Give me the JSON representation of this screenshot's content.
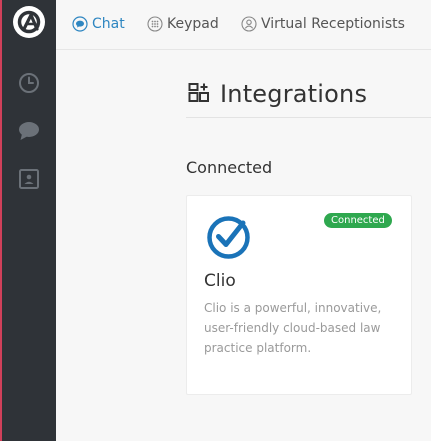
{
  "topbar": {
    "tabs": [
      {
        "label": "Chat",
        "icon": "chat-bubble-icon",
        "active": true
      },
      {
        "label": "Keypad",
        "icon": "keypad-icon",
        "active": false
      },
      {
        "label": "Virtual Receptionists",
        "icon": "receptionist-icon",
        "active": false
      }
    ]
  },
  "sidebar": {
    "items": [
      {
        "icon": "app-logo-icon"
      },
      {
        "icon": "clock-icon"
      },
      {
        "icon": "chat-icon"
      },
      {
        "icon": "contact-card-icon"
      }
    ]
  },
  "page": {
    "title": "Integrations",
    "title_icon": "integrations-icon"
  },
  "section": {
    "title": "Connected"
  },
  "integration": {
    "name": "Clio",
    "status": "Connected",
    "description": "Clio is a powerful, innovative, user-friendly cloud-based law practice platform.",
    "logo_icon": "clio-logo-icon"
  },
  "colors": {
    "sidebar_bg": "#2f3338",
    "accent": "#2e86c1",
    "badge": "#2fa84f",
    "clio_blue": "#1a73b8"
  }
}
